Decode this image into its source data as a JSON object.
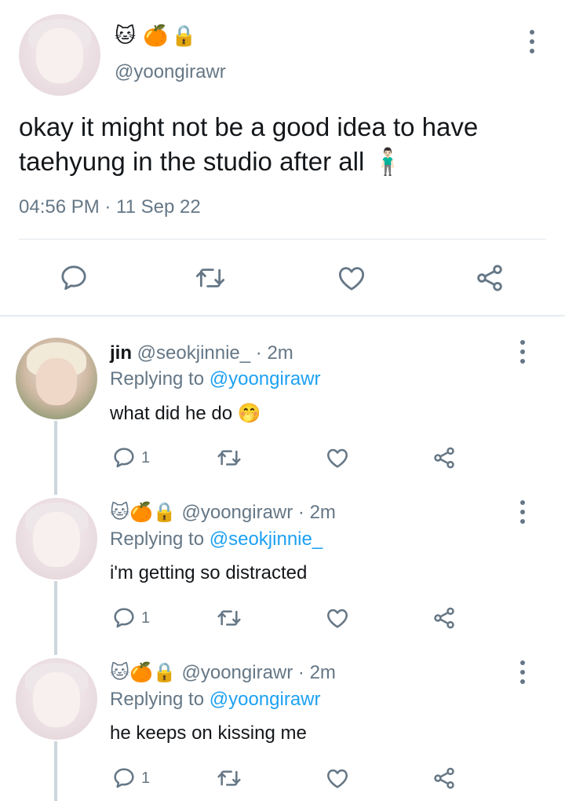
{
  "main_tweet": {
    "emoji": [
      "🐱",
      "🍊",
      "🔒"
    ],
    "handle": "@yoongirawr",
    "text_line1": "okay it might not be a good idea to have",
    "text_line2": "taehyung in the studio after all 🧍🏻‍♂️",
    "timestamp": "04:56 PM · 11 Sep 22"
  },
  "replies": [
    {
      "name": "jin",
      "handle": "@seokjinnie_",
      "time": "· 2m",
      "replying_label": "Replying to",
      "replying_to": "@yoongirawr",
      "text": "what did he do 🤭",
      "reply_count": "1"
    },
    {
      "emoji": [
        "🐱",
        "🍊",
        "🔒"
      ],
      "handle": "@yoongirawr",
      "time": "· 2m",
      "replying_label": "Replying to",
      "replying_to": "@seokjinnie_",
      "text": "i'm getting so distracted",
      "reply_count": "1"
    },
    {
      "emoji": [
        "🐱",
        "🍊",
        "🔒"
      ],
      "handle": "@yoongirawr",
      "time": "· 2m",
      "replying_label": "Replying to",
      "replying_to": "@yoongirawr",
      "text": "he keeps on kissing me",
      "reply_count": "1"
    }
  ],
  "icons": {
    "reply": "reply-icon",
    "retweet": "retweet-icon",
    "like": "like-icon",
    "share": "share-icon",
    "more": "more-options-icon"
  },
  "colors": {
    "link": "#1da1f2",
    "secondary_text": "#657786",
    "icon": "#657786"
  }
}
